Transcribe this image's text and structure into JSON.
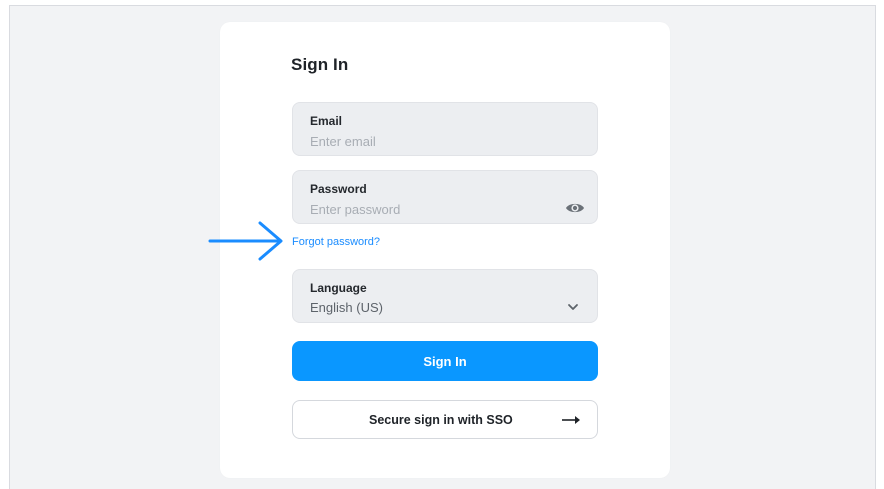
{
  "signin": {
    "title": "Sign In",
    "email": {
      "label": "Email",
      "placeholder": "Enter email",
      "value": ""
    },
    "password": {
      "label": "Password",
      "placeholder": "Enter password",
      "value": "",
      "toggle_icon": "eye-icon"
    },
    "forgot_link": "Forgot password?",
    "language": {
      "label": "Language",
      "selected": "English (US)",
      "icon": "chevron-down-icon"
    },
    "submit_label": "Sign In",
    "sso_label": "Secure sign in with SSO",
    "sso_icon": "arrow-right-icon"
  },
  "colors": {
    "accent": "#0a97ff",
    "link": "#1a8cff",
    "annotation": "#1a8cff",
    "field_bg": "#eceef1",
    "page_bg": "#f2f3f5"
  }
}
